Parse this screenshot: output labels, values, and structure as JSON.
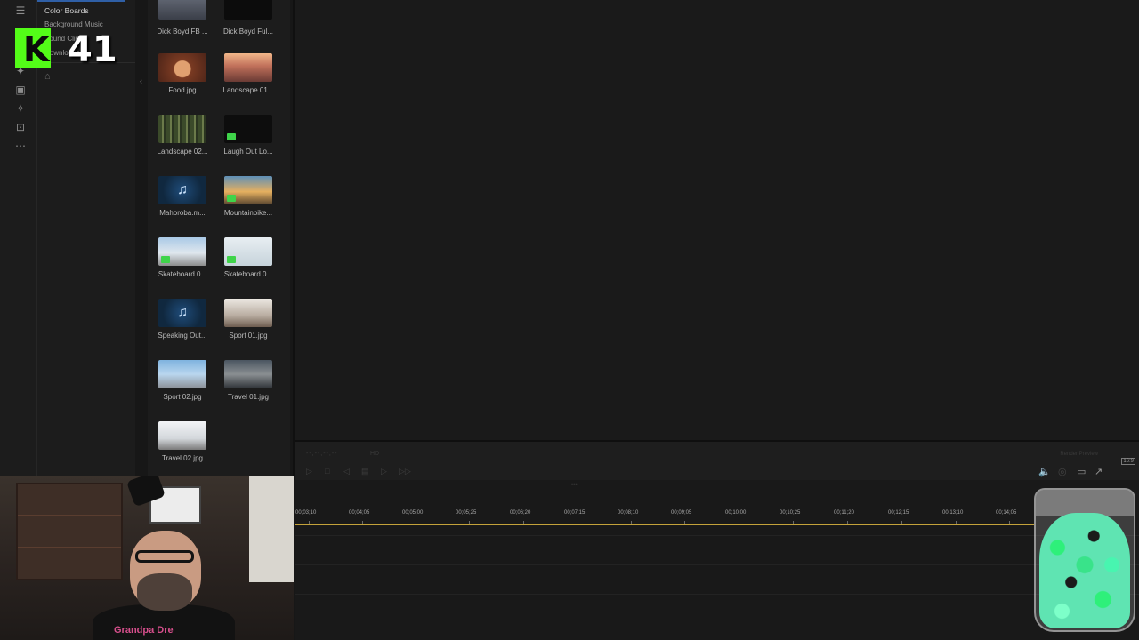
{
  "tree": {
    "items": [
      "Color Boards",
      "Background Music",
      "Sound Clips",
      "Downloaded"
    ]
  },
  "media": {
    "items": [
      {
        "label": "Dick Boyd FB ...",
        "type": "video"
      },
      {
        "label": "Dick Boyd Ful...",
        "type": "video"
      },
      {
        "label": "Food.jpg",
        "type": "image"
      },
      {
        "label": "Landscape 01...",
        "type": "image"
      },
      {
        "label": "Landscape 02...",
        "type": "image"
      },
      {
        "label": "Laugh Out Lo...",
        "type": "video"
      },
      {
        "label": "Mahoroba.m...",
        "type": "audio"
      },
      {
        "label": "Mountainbike...",
        "type": "video"
      },
      {
        "label": "Skateboard 0...",
        "type": "video"
      },
      {
        "label": "Skateboard 0...",
        "type": "video"
      },
      {
        "label": "Speaking Out...",
        "type": "audio"
      },
      {
        "label": "Sport 01.jpg",
        "type": "image"
      },
      {
        "label": "Sport 02.jpg",
        "type": "image"
      },
      {
        "label": "Travel 01.jpg",
        "type": "image"
      },
      {
        "label": "Travel 02.jpg",
        "type": "image"
      }
    ]
  },
  "preview": {
    "timecode": "--;--;--;--",
    "quality": "HD",
    "render_preview": "Render Preview",
    "aspect_ratio": "16:9"
  },
  "timeline": {
    "ticks": [
      "00;03;10",
      "00;04;05",
      "00;05;00",
      "00;05;25",
      "00;06;20",
      "00;07;15",
      "00;08;10",
      "00;09;05",
      "00;10;00",
      "00;10;25",
      "00;11;20",
      "00;12;15",
      "00;13;10",
      "00;14;05"
    ]
  },
  "overlay": {
    "kick_letter": "K",
    "sub_count": "41",
    "shirt_text": "Grandpa Dre"
  },
  "colors": {
    "kick_green": "#53fc18",
    "ruler_gold": "#c4a23a",
    "selection_blue": "#2f5fa6"
  }
}
